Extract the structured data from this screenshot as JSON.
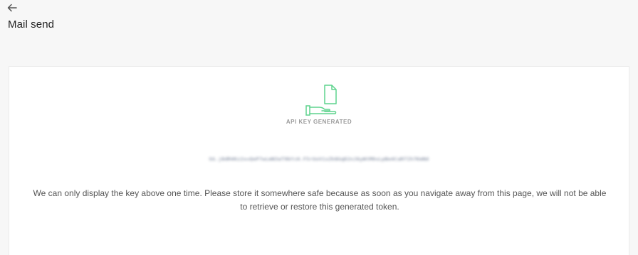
{
  "header": {
    "back_icon": "arrow-left-icon",
    "title": "Mail send"
  },
  "card": {
    "graphic_icon": "hand-holding-document-icon",
    "accent_color": "#5fd38d",
    "status_label": "API KEY GENERATED",
    "api_key": "SG.j8dR4Kz2xvQeP7wLmN3aT9bYcH.F5rUoV1sZk8GqD2nJ6yWtM0xLpBe4CaRfIh7KmNd",
    "warning": "We can only display the key above one time. Please store it somewhere safe because as soon as you navigate away from this page, we will not be able to retrieve or restore this generated token."
  }
}
